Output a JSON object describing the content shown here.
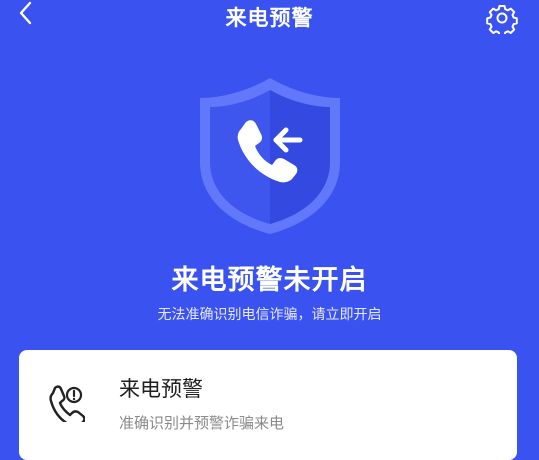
{
  "header": {
    "title": "来电预警",
    "back_icon": "chevron-left-icon",
    "settings_icon": "gear-icon"
  },
  "hero": {
    "icon": "shield-incoming-call-icon",
    "status": "来电预警未开启",
    "subtitle": "无法准确识别电信诈骗，请立即开启"
  },
  "card": {
    "icon": "phone-warning-icon",
    "title": "来电预警",
    "description": "准确识别并预警诈骗来电"
  },
  "colors": {
    "background": "#3a52f0",
    "card": "#ffffff"
  }
}
